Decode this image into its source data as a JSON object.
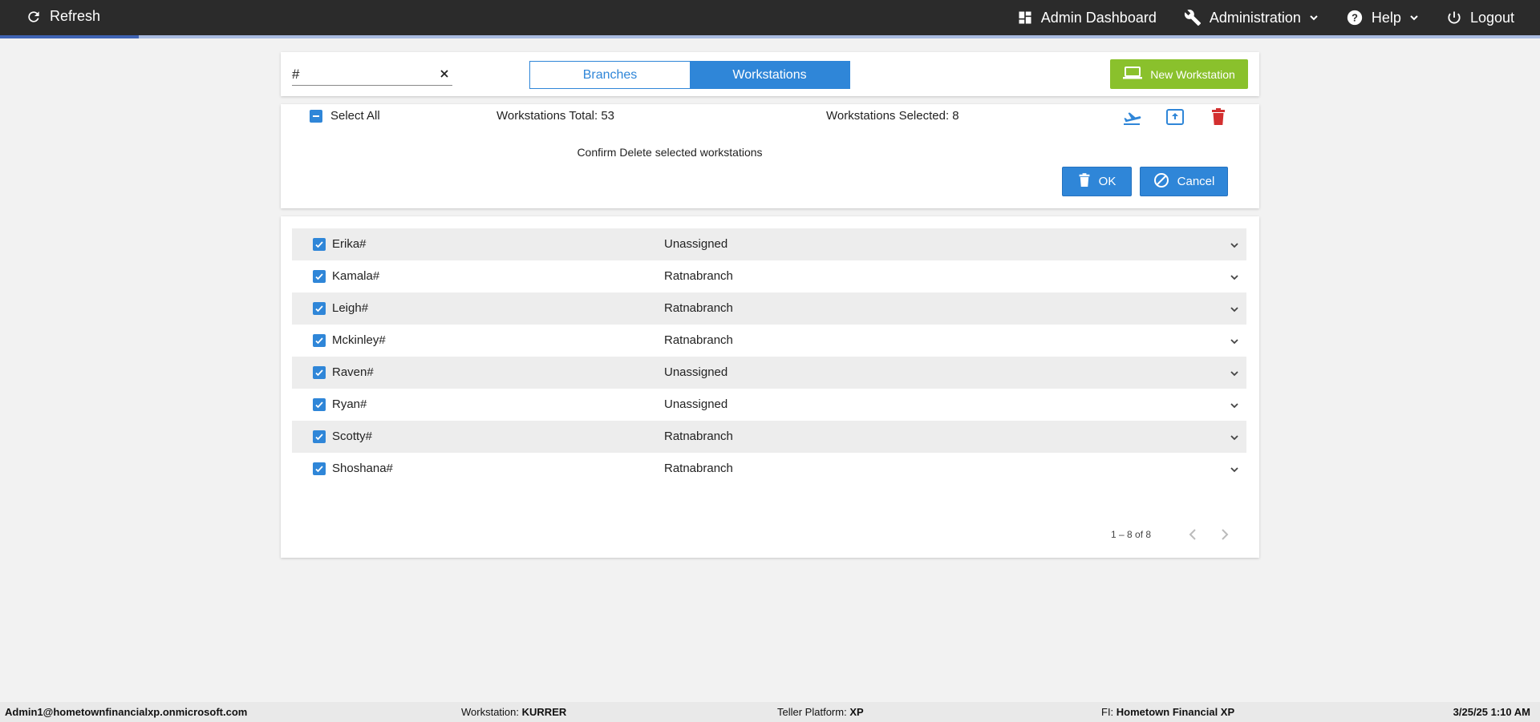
{
  "topbar": {
    "refresh_label": "Refresh",
    "admin_dashboard_label": "Admin Dashboard",
    "administration_label": "Administration",
    "help_label": "Help",
    "logout_label": "Logout",
    "progress_fraction": 0.09
  },
  "search": {
    "value": "#",
    "placeholder": ""
  },
  "tabs": {
    "branches": "Branches",
    "workstations": "Workstations",
    "active": "Workstations"
  },
  "new_workstation_label": "New Workstation",
  "bulk": {
    "select_all_label": "Select All",
    "total_text": "Workstations Total: 53",
    "selected_text": "Workstations Selected: 8",
    "confirm_text": "Confirm Delete selected workstations",
    "ok_label": "OK",
    "cancel_label": "Cancel"
  },
  "rows": [
    {
      "name": "Erika#",
      "branch": "Unassigned",
      "checked": true
    },
    {
      "name": "Kamala#",
      "branch": "Ratnabranch",
      "checked": true
    },
    {
      "name": "Leigh#",
      "branch": "Ratnabranch",
      "checked": true
    },
    {
      "name": "Mckinley#",
      "branch": "Ratnabranch",
      "checked": true
    },
    {
      "name": "Raven#",
      "branch": "Unassigned",
      "checked": true
    },
    {
      "name": "Ryan#",
      "branch": "Unassigned",
      "checked": true
    },
    {
      "name": "Scotty#",
      "branch": "Ratnabranch",
      "checked": true
    },
    {
      "name": "Shoshana#",
      "branch": "Ratnabranch",
      "checked": true
    }
  ],
  "pager": {
    "range_text": "1 – 8 of 8"
  },
  "footer": {
    "user": "Admin1@hometownfinancialxp.onmicrosoft.com",
    "workstation_label": "Workstation:",
    "workstation_value": "KURRER",
    "platform_label": "Teller Platform:",
    "platform_value": "XP",
    "fi_label": "FI:",
    "fi_value": "Hometown Financial XP",
    "datetime": "3/25/25 1:10 AM"
  },
  "colors": {
    "accent": "#2f86d8",
    "new_button": "#8ac12c",
    "delete_icon": "#d32f2f",
    "topbar": "#2b2b2b"
  }
}
